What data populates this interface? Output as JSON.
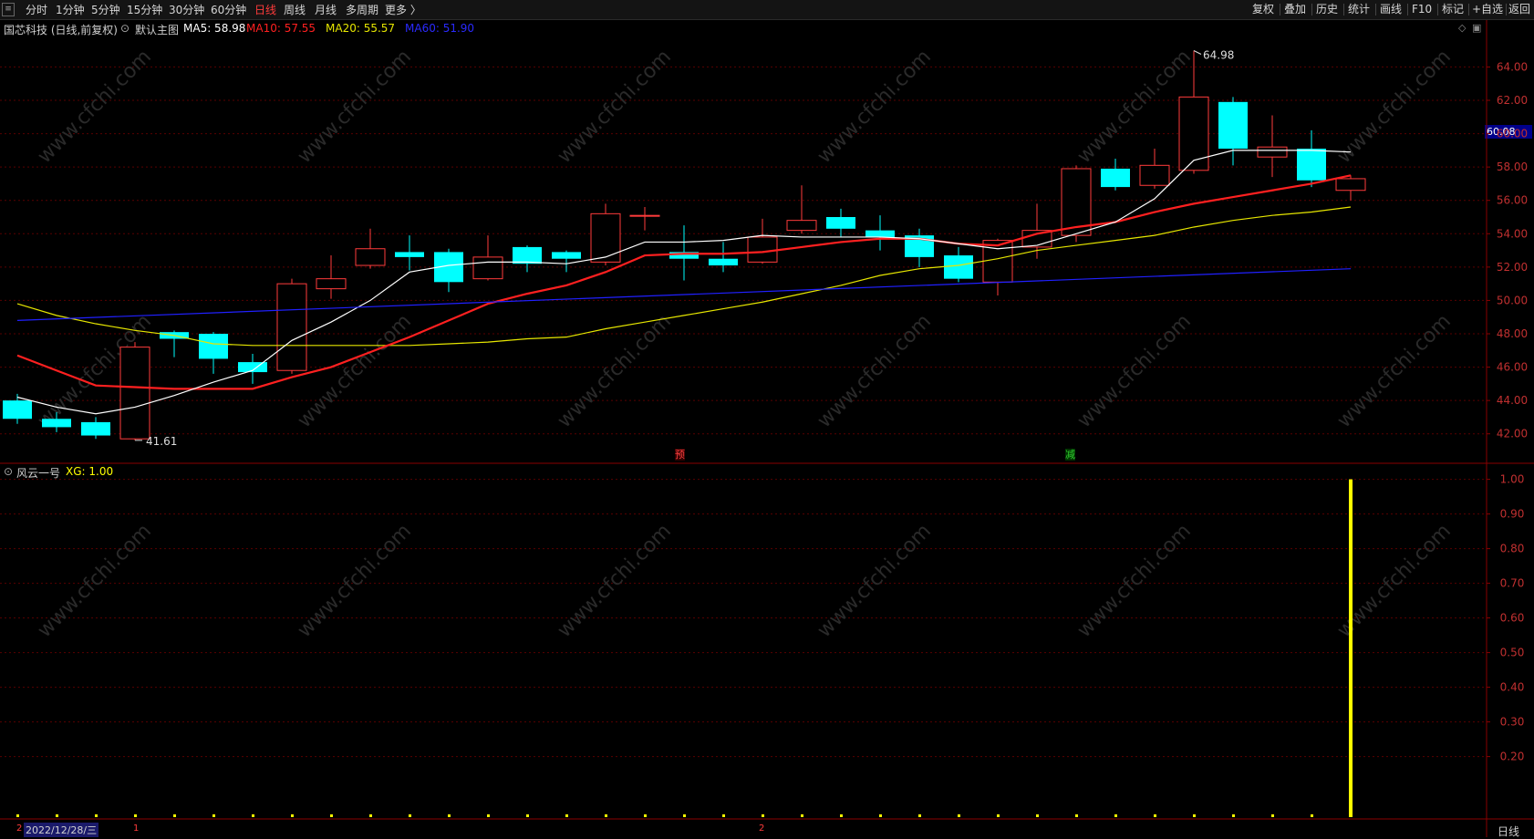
{
  "toolbar": {
    "periods": [
      "分时",
      "1分钟",
      "5分钟",
      "15分钟",
      "30分钟",
      "60分钟",
      "日线",
      "周线",
      "月线",
      "多周期",
      "更多 〉"
    ],
    "active": "日线",
    "right_buttons": [
      "复权",
      "叠加",
      "历史",
      "统计",
      "画线",
      "F10",
      "+自选",
      "返回"
    ],
    "corner_label": "标记"
  },
  "main_panel": {
    "title": "国芯科技 (日线,前复权)",
    "template": "默认主图",
    "ma": [
      {
        "label": "MA5: 58.98",
        "color": "#ffffff"
      },
      {
        "label": "MA10: 57.55",
        "color": "#ff2020"
      },
      {
        "label": "MA20: 55.57",
        "color": "#e6e600"
      },
      {
        "label": "MA60: 51.90",
        "color": "#2a2aff"
      }
    ],
    "high_label": "64.98",
    "low_label": "41.61",
    "current_price": "60.08",
    "markers": [
      {
        "text": "预",
        "color": "#ff4040"
      },
      {
        "text": "减",
        "color": "#30d030"
      }
    ]
  },
  "indicator_panel": {
    "title": "风云一号",
    "value_label": "XG: 1.00"
  },
  "bottom": {
    "date": "2022/12/28/三",
    "period_label": "日线",
    "month_marks": [
      "2",
      "1",
      "2"
    ]
  },
  "watermark": "www.cfchi.com",
  "colors": {
    "up": "#ff3b3b",
    "down": "#00ffff",
    "ma5": "#ffffff",
    "ma10": "#ff2020",
    "ma20": "#e6e600",
    "ma60": "#2020ff",
    "signal": "#ffff00",
    "grid": "#5a0000"
  },
  "chart_data": [
    {
      "type": "candlestick",
      "y_ticks": [
        "64.00",
        "62.00",
        "60.00",
        "58.00",
        "56.00",
        "54.00",
        "52.00",
        "50.00",
        "48.00",
        "46.00",
        "44.00",
        "42.00"
      ],
      "ylim": [
        41,
        65.5
      ],
      "candles": [
        {
          "o": 44.0,
          "c": 42.9,
          "h": 44.4,
          "l": 42.6
        },
        {
          "o": 42.9,
          "c": 42.4,
          "h": 43.3,
          "l": 42.1
        },
        {
          "o": 42.7,
          "c": 41.9,
          "h": 43.0,
          "l": 41.7
        },
        {
          "o": 41.7,
          "c": 47.2,
          "h": 47.5,
          "l": 41.61
        },
        {
          "o": 48.1,
          "c": 47.7,
          "h": 48.2,
          "l": 46.6
        },
        {
          "o": 48.0,
          "c": 46.5,
          "h": 48.1,
          "l": 45.6
        },
        {
          "o": 46.3,
          "c": 45.7,
          "h": 46.8,
          "l": 45.0
        },
        {
          "o": 45.8,
          "c": 51.0,
          "h": 51.3,
          "l": 45.6
        },
        {
          "o": 50.7,
          "c": 51.3,
          "h": 52.7,
          "l": 50.1
        },
        {
          "o": 52.1,
          "c": 53.1,
          "h": 54.3,
          "l": 51.9
        },
        {
          "o": 52.9,
          "c": 52.6,
          "h": 53.9,
          "l": 51.8
        },
        {
          "o": 52.9,
          "c": 51.1,
          "h": 53.1,
          "l": 50.5
        },
        {
          "o": 51.3,
          "c": 52.6,
          "h": 53.9,
          "l": 51.2
        },
        {
          "o": 53.2,
          "c": 52.2,
          "h": 53.3,
          "l": 51.7
        },
        {
          "o": 52.9,
          "c": 52.5,
          "h": 53.0,
          "l": 51.7
        },
        {
          "o": 52.3,
          "c": 55.2,
          "h": 55.8,
          "l": 52.1
        },
        {
          "o": 55.1,
          "c": 55.1,
          "h": 55.6,
          "l": 54.2
        },
        {
          "o": 52.9,
          "c": 52.5,
          "h": 54.5,
          "l": 51.2
        },
        {
          "o": 52.5,
          "c": 52.1,
          "h": 53.5,
          "l": 51.7
        },
        {
          "o": 52.3,
          "c": 53.8,
          "h": 54.9,
          "l": 52.2
        },
        {
          "o": 54.2,
          "c": 54.8,
          "h": 56.9,
          "l": 54.0
        },
        {
          "o": 55.0,
          "c": 54.3,
          "h": 55.5,
          "l": 53.8
        },
        {
          "o": 54.2,
          "c": 53.8,
          "h": 55.1,
          "l": 53.0
        },
        {
          "o": 53.9,
          "c": 52.6,
          "h": 54.3,
          "l": 52.0
        },
        {
          "o": 52.7,
          "c": 51.3,
          "h": 53.2,
          "l": 51.1
        },
        {
          "o": 51.1,
          "c": 53.6,
          "h": 53.7,
          "l": 50.3
        },
        {
          "o": 53.2,
          "c": 54.2,
          "h": 55.8,
          "l": 52.5
        },
        {
          "o": 53.9,
          "c": 57.9,
          "h": 58.1,
          "l": 53.5
        },
        {
          "o": 57.9,
          "c": 56.8,
          "h": 58.5,
          "l": 56.6
        },
        {
          "o": 56.9,
          "c": 58.1,
          "h": 59.1,
          "l": 56.7
        },
        {
          "o": 57.8,
          "c": 62.2,
          "h": 64.98,
          "l": 57.6
        },
        {
          "o": 61.9,
          "c": 59.1,
          "h": 62.2,
          "l": 58.1
        },
        {
          "o": 58.6,
          "c": 59.2,
          "h": 61.1,
          "l": 57.4
        },
        {
          "o": 59.1,
          "c": 57.2,
          "h": 60.2,
          "l": 56.8
        },
        {
          "o": 56.6,
          "c": 57.3,
          "h": 57.5,
          "l": 56.0
        }
      ],
      "ma5": [
        44.2,
        43.6,
        43.2,
        43.6,
        44.3,
        45.1,
        45.8,
        47.6,
        48.7,
        50.0,
        51.7,
        52.1,
        52.3,
        52.3,
        52.2,
        52.6,
        53.5,
        53.5,
        53.6,
        53.9,
        53.8,
        53.8,
        53.8,
        53.7,
        53.4,
        53.1,
        53.3,
        54.0,
        54.7,
        56.1,
        58.4,
        59.0,
        59.0,
        59.0,
        58.9
      ],
      "ma10": [
        46.7,
        45.8,
        44.9,
        44.8,
        44.7,
        44.7,
        44.7,
        45.4,
        46.0,
        46.9,
        47.8,
        48.8,
        49.8,
        50.4,
        50.9,
        51.7,
        52.7,
        52.8,
        52.8,
        52.9,
        53.2,
        53.5,
        53.7,
        53.7,
        53.4,
        53.3,
        54.0,
        54.4,
        54.7,
        55.3,
        55.8,
        56.2,
        56.6,
        57.0,
        57.5
      ],
      "ma20": [
        49.8,
        49.1,
        48.6,
        48.2,
        47.9,
        47.4,
        47.3,
        47.3,
        47.3,
        47.3,
        47.3,
        47.4,
        47.5,
        47.7,
        47.8,
        48.3,
        48.7,
        49.1,
        49.5,
        49.9,
        50.4,
        50.9,
        51.5,
        51.9,
        52.1,
        52.5,
        53.0,
        53.3,
        53.6,
        53.9,
        54.4,
        54.8,
        55.1,
        55.3,
        55.6
      ],
      "ma60_start": 48.8,
      "ma60_end": 51.9
    },
    {
      "type": "bar",
      "y_ticks": [
        "1.00",
        "0.90",
        "0.80",
        "0.70",
        "0.60",
        "0.50",
        "0.40",
        "0.30",
        "0.20"
      ],
      "ylim": [
        0.02,
        1.02
      ],
      "values": [
        0,
        0,
        0,
        0,
        0,
        0,
        0,
        0,
        0,
        0,
        0,
        0,
        0,
        0,
        0,
        0,
        0,
        0,
        0,
        0,
        0,
        0,
        0,
        0,
        0,
        0,
        0,
        0,
        0,
        0,
        0,
        0,
        0,
        0,
        1
      ]
    }
  ]
}
